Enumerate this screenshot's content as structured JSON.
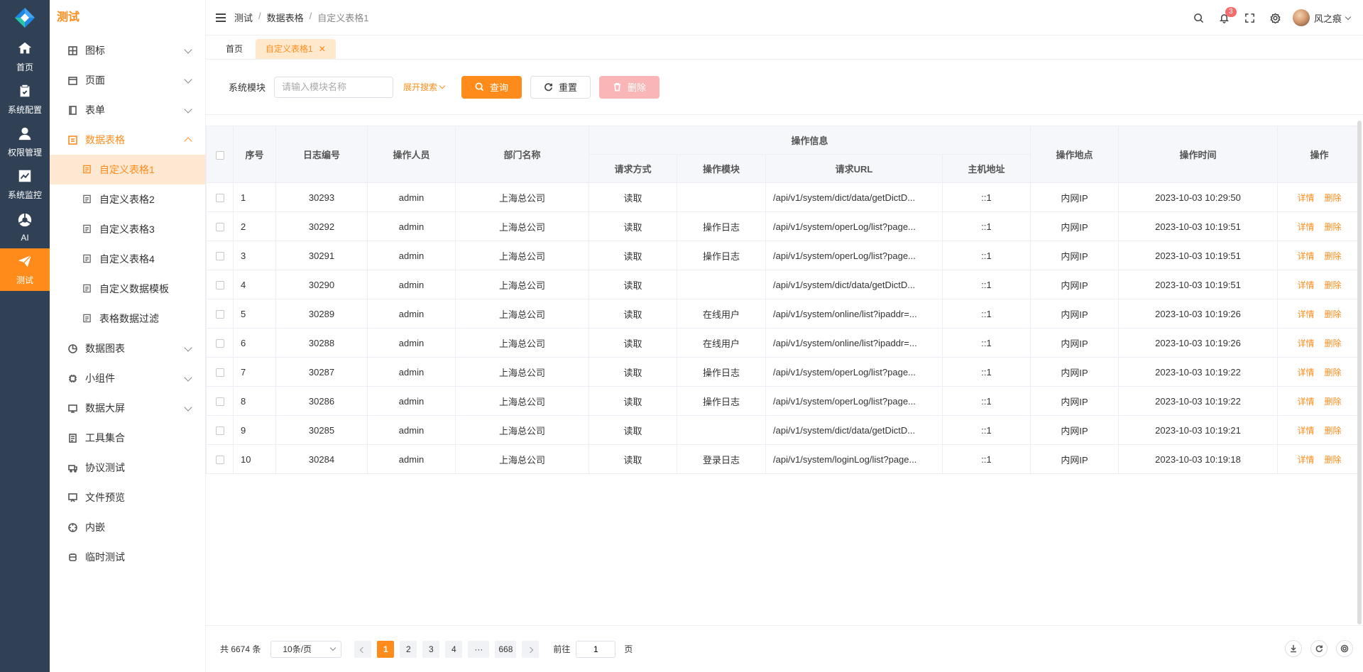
{
  "rail": {
    "items": [
      {
        "label": "首页",
        "icon": "home-icon"
      },
      {
        "label": "系统配置",
        "icon": "clipboard-icon"
      },
      {
        "label": "权限管理",
        "icon": "user-icon"
      },
      {
        "label": "系统监控",
        "icon": "chart-icon"
      },
      {
        "label": "AI",
        "icon": "ai-icon"
      },
      {
        "label": "测试",
        "icon": "paper-plane-icon",
        "active": true
      }
    ]
  },
  "sidebar": {
    "title": "测试",
    "menu": [
      {
        "label": "图标",
        "expandable": true
      },
      {
        "label": "页面",
        "expandable": true
      },
      {
        "label": "表单",
        "expandable": true
      },
      {
        "label": "数据表格",
        "expandable": true,
        "open": true
      },
      {
        "label": "数据图表",
        "expandable": true
      },
      {
        "label": "小组件",
        "expandable": true
      },
      {
        "label": "数据大屏",
        "expandable": true
      },
      {
        "label": "工具集合"
      },
      {
        "label": "协议测试"
      },
      {
        "label": "文件预览"
      },
      {
        "label": "内嵌"
      },
      {
        "label": "临时测试"
      }
    ],
    "submenu": [
      {
        "label": "自定义表格1",
        "active": true
      },
      {
        "label": "自定义表格2"
      },
      {
        "label": "自定义表格3"
      },
      {
        "label": "自定义表格4"
      },
      {
        "label": "自定义数据模板"
      },
      {
        "label": "表格数据过滤"
      }
    ]
  },
  "header": {
    "breadcrumb": [
      "测试",
      "数据表格",
      "自定义表格1"
    ],
    "notifications": "3",
    "user_name": "风之痕"
  },
  "tabs": [
    {
      "label": "首页"
    },
    {
      "label": "自定义表格1",
      "active": true
    }
  ],
  "search": {
    "label": "系统模块",
    "placeholder": "请输入模块名称",
    "expand": "展开搜索",
    "query": "查询",
    "reset": "重置",
    "delete": "删除"
  },
  "table": {
    "headers": {
      "seq": "序号",
      "log_no": "日志编号",
      "operator": "操作人员",
      "dept": "部门名称",
      "group": "操作信息",
      "method": "请求方式",
      "module": "操作模块",
      "url": "请求URL",
      "host": "主机地址",
      "location": "操作地点",
      "time": "操作时间",
      "actions": "操作"
    },
    "detail_label": "详情",
    "delete_label": "删除",
    "rows": [
      {
        "seq": "1",
        "id": "30293",
        "user": "admin",
        "dept": "上海总公司",
        "method": "读取",
        "module": "",
        "url": "/api/v1/system/dict/data/getDictD...",
        "host": "::1",
        "loc": "内网IP",
        "time": "2023-10-03 10:29:50"
      },
      {
        "seq": "2",
        "id": "30292",
        "user": "admin",
        "dept": "上海总公司",
        "method": "读取",
        "module": "操作日志",
        "url": "/api/v1/system/operLog/list?page...",
        "host": "::1",
        "loc": "内网IP",
        "time": "2023-10-03 10:19:51"
      },
      {
        "seq": "3",
        "id": "30291",
        "user": "admin",
        "dept": "上海总公司",
        "method": "读取",
        "module": "操作日志",
        "url": "/api/v1/system/operLog/list?page...",
        "host": "::1",
        "loc": "内网IP",
        "time": "2023-10-03 10:19:51"
      },
      {
        "seq": "4",
        "id": "30290",
        "user": "admin",
        "dept": "上海总公司",
        "method": "读取",
        "module": "",
        "url": "/api/v1/system/dict/data/getDictD...",
        "host": "::1",
        "loc": "内网IP",
        "time": "2023-10-03 10:19:51"
      },
      {
        "seq": "5",
        "id": "30289",
        "user": "admin",
        "dept": "上海总公司",
        "method": "读取",
        "module": "在线用户",
        "url": "/api/v1/system/online/list?ipaddr=...",
        "host": "::1",
        "loc": "内网IP",
        "time": "2023-10-03 10:19:26"
      },
      {
        "seq": "6",
        "id": "30288",
        "user": "admin",
        "dept": "上海总公司",
        "method": "读取",
        "module": "在线用户",
        "url": "/api/v1/system/online/list?ipaddr=...",
        "host": "::1",
        "loc": "内网IP",
        "time": "2023-10-03 10:19:26"
      },
      {
        "seq": "7",
        "id": "30287",
        "user": "admin",
        "dept": "上海总公司",
        "method": "读取",
        "module": "操作日志",
        "url": "/api/v1/system/operLog/list?page...",
        "host": "::1",
        "loc": "内网IP",
        "time": "2023-10-03 10:19:22"
      },
      {
        "seq": "8",
        "id": "30286",
        "user": "admin",
        "dept": "上海总公司",
        "method": "读取",
        "module": "操作日志",
        "url": "/api/v1/system/operLog/list?page...",
        "host": "::1",
        "loc": "内网IP",
        "time": "2023-10-03 10:19:22"
      },
      {
        "seq": "9",
        "id": "30285",
        "user": "admin",
        "dept": "上海总公司",
        "method": "读取",
        "module": "",
        "url": "/api/v1/system/dict/data/getDictD...",
        "host": "::1",
        "loc": "内网IP",
        "time": "2023-10-03 10:19:21"
      },
      {
        "seq": "10",
        "id": "30284",
        "user": "admin",
        "dept": "上海总公司",
        "method": "读取",
        "module": "登录日志",
        "url": "/api/v1/system/loginLog/list?page...",
        "host": "::1",
        "loc": "内网IP",
        "time": "2023-10-03 10:19:18"
      }
    ]
  },
  "pagination": {
    "total": "共 6674 条",
    "page_size": "10条/页",
    "pages": [
      "1",
      "2",
      "3",
      "4",
      "···",
      "668"
    ],
    "current": "1",
    "goto_label": "前往",
    "goto_value": "1",
    "page_suffix": "页"
  },
  "colors": {
    "accent": "#ff8c1a",
    "rail_bg": "#304156",
    "danger_disabled": "#fab6b6"
  }
}
